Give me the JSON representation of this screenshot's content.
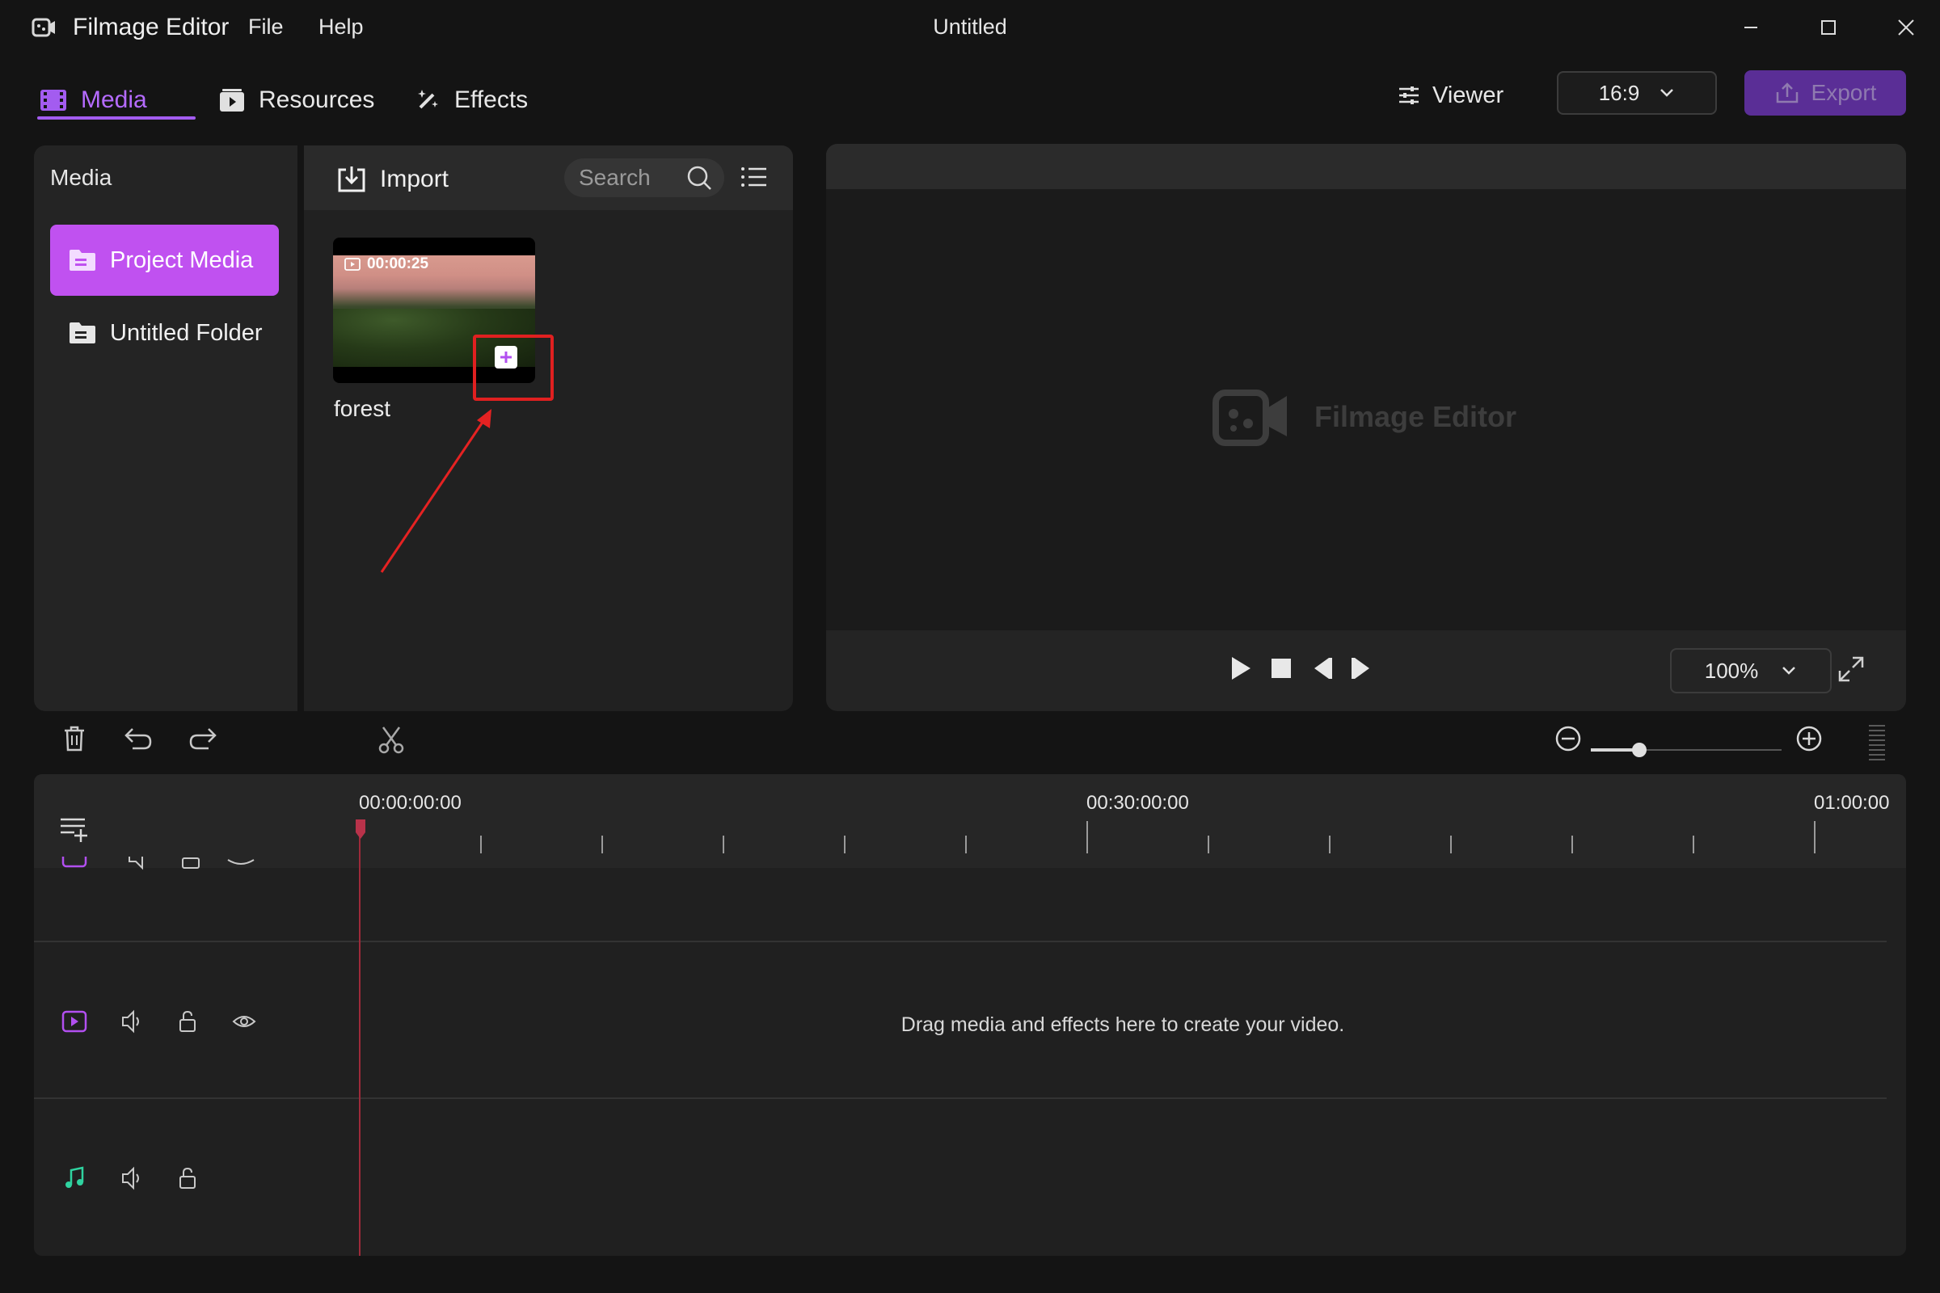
{
  "app": {
    "name": "Filmage Editor",
    "window_title": "Untitled"
  },
  "menu": {
    "file": "File",
    "help": "Help"
  },
  "tabs": {
    "media": "Media",
    "resources": "Resources",
    "effects": "Effects",
    "active": "Media"
  },
  "toolbar_right": {
    "viewer": "Viewer",
    "aspect_ratio": "16:9",
    "export": "Export"
  },
  "media_panel": {
    "title": "Media",
    "folders": [
      {
        "label": "Project Media",
        "selected": true
      },
      {
        "label": "Untitled Folder",
        "selected": false
      }
    ],
    "import_label": "Import",
    "search_placeholder": "Search",
    "items": [
      {
        "name": "forest",
        "duration": "00:00:25"
      }
    ]
  },
  "viewer": {
    "watermark": "Filmage Editor",
    "zoom": "100%"
  },
  "timeline": {
    "ruler_labels": [
      "00:00:00:00",
      "00:30:00:00",
      "01:00:00"
    ],
    "empty_message": "Drag media and effects here to create your video."
  },
  "colors": {
    "accent": "#c051f0",
    "accent_text": "#b56bff",
    "export_bg": "#5a2e96",
    "highlight": "#e02020",
    "audio_icon": "#2fd3a0"
  }
}
